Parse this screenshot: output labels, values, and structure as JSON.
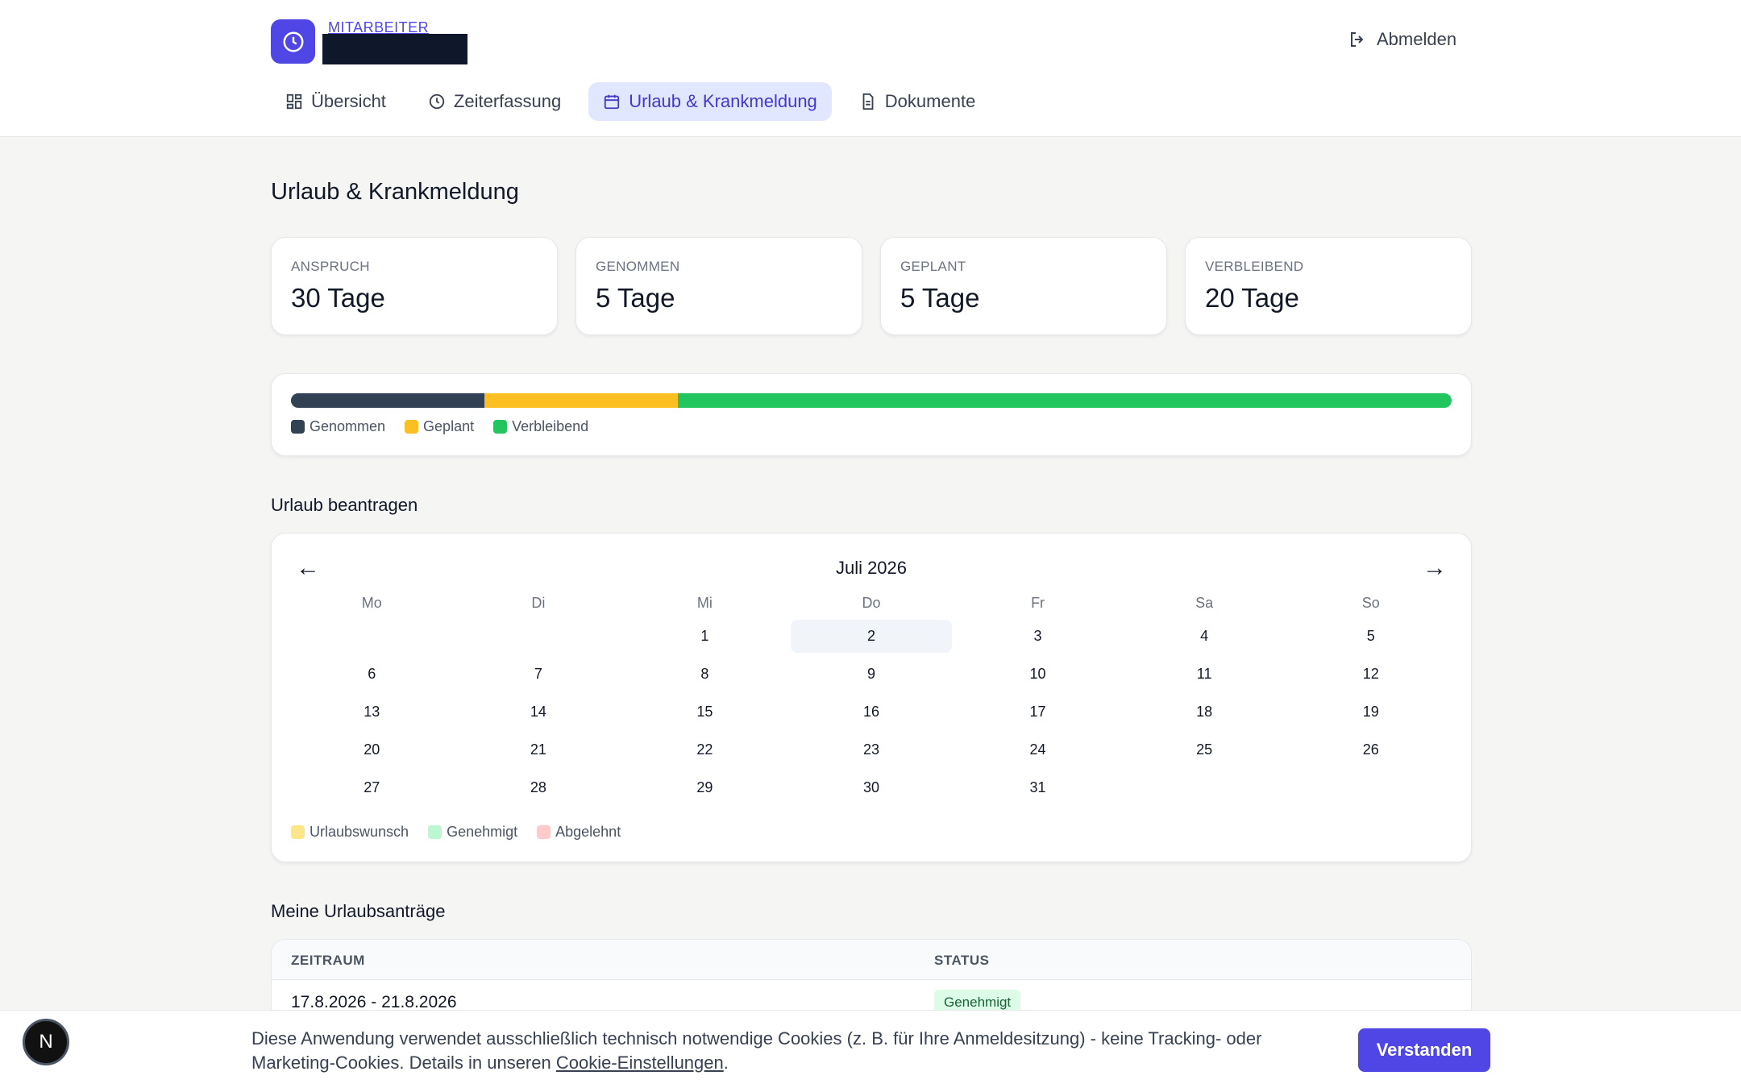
{
  "colors": {
    "accent": "#4f46e5",
    "taken": "#334155",
    "planned": "#fbbf24",
    "remaining": "#22c55e",
    "request": "#fde68a",
    "approved": "#bbf7d0",
    "rejected": "#fecaca"
  },
  "header": {
    "role": "MITARBEITER",
    "logout_label": "Abmelden"
  },
  "tabs": [
    {
      "label": "Übersicht",
      "icon": "grid-icon"
    },
    {
      "label": "Zeiterfassung",
      "icon": "clock-icon"
    },
    {
      "label": "Urlaub & Krankmeldung",
      "icon": "calendar-icon",
      "active": true
    },
    {
      "label": "Dokumente",
      "icon": "document-icon"
    }
  ],
  "page": {
    "title": "Urlaub & Krankmeldung"
  },
  "stats": [
    {
      "label": "ANSPRUCH",
      "value": "30 Tage"
    },
    {
      "label": "GENOMMEN",
      "value": "5 Tage"
    },
    {
      "label": "GEPLANT",
      "value": "5 Tage"
    },
    {
      "label": "VERBLEIBEND",
      "value": "20 Tage"
    }
  ],
  "progress": {
    "taken_days": 5,
    "planned_days": 5,
    "remaining_days": 20,
    "legend": [
      "Genommen",
      "Geplant",
      "Verbleibend"
    ]
  },
  "request": {
    "heading": "Urlaub beantragen"
  },
  "calendar": {
    "month_title": "Juli 2026",
    "prev": "←",
    "next": "→",
    "weekdays": [
      "Mo",
      "Di",
      "Mi",
      "Do",
      "Fr",
      "Sa",
      "So"
    ],
    "first_weekday_index": 2,
    "days_in_month": 31,
    "today": 2,
    "legend": [
      "Urlaubswunsch",
      "Genehmigt",
      "Abgelehnt"
    ]
  },
  "requests": {
    "heading": "Meine Urlaubsanträge",
    "columns": [
      "ZEITRAUM",
      "STATUS"
    ],
    "rows": [
      {
        "period": "17.8.2026 - 21.8.2026",
        "status": "Genehmigt"
      }
    ]
  },
  "cookie": {
    "text": "Diese Anwendung verwendet ausschließlich technisch notwendige Cookies (z. B. für Ihre Anmeldesitzung) - keine Tracking- oder Marketing-Cookies. Details in unseren ",
    "link": "Cookie-Einstellungen",
    "suffix": ".",
    "button": "Verstanden"
  },
  "dev_badge": "N"
}
